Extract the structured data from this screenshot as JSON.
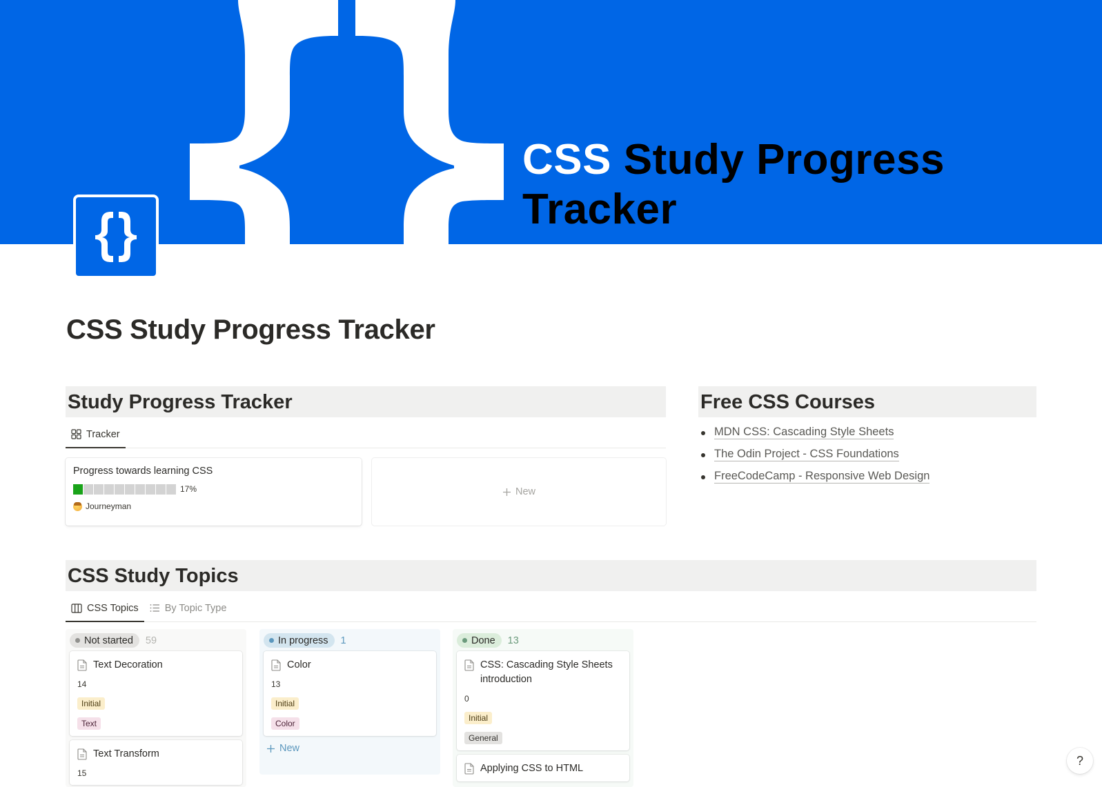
{
  "cover": {
    "title_highlight": "CSS",
    "title_rest_line1": " Study Progress",
    "title_line2": "Tracker",
    "background_color": "#0066e6",
    "icon": "curly-braces-icon"
  },
  "page": {
    "icon": "curly-braces-icon",
    "title": "CSS Study Progress Tracker"
  },
  "tracker_section": {
    "heading": "Study Progress Tracker",
    "tabs": [
      {
        "label": "Tracker",
        "icon": "gallery-icon",
        "active": true
      }
    ],
    "progress_card": {
      "title": "Progress towards learning CSS",
      "progress_percent": 17,
      "progress_label": "17%",
      "segments_total": 10,
      "segments_filled": 1,
      "level_emoji": "face-emoji",
      "level_label": "Journeyman"
    },
    "new_card_label": "New"
  },
  "courses_section": {
    "heading": "Free CSS Courses",
    "links": [
      {
        "label": "MDN CSS: Cascading Style Sheets"
      },
      {
        "label": "The Odin Project - CSS Foundations"
      },
      {
        "label": "FreeCodeCamp - Responsive Web Design"
      }
    ]
  },
  "topics_section": {
    "heading": "CSS Study Topics",
    "tabs": [
      {
        "label": "CSS Topics",
        "icon": "board-icon",
        "active": true
      },
      {
        "label": "By Topic Type",
        "icon": "list-icon",
        "active": false
      }
    ],
    "columns": [
      {
        "status": "Not started",
        "count": "59",
        "color": "#91918e",
        "cards": [
          {
            "title": "Text Decoration",
            "number": "14",
            "level_tag": "Initial",
            "type_tag": "Text"
          },
          {
            "title": "Text Transform",
            "number": "15"
          }
        ]
      },
      {
        "status": "In progress",
        "count": "1",
        "color": "#5b97bd",
        "cards": [
          {
            "title": "Color",
            "number": "13",
            "level_tag": "Initial",
            "type_tag": "Color"
          }
        ],
        "add_label": "New"
      },
      {
        "status": "Done",
        "count": "13",
        "color": "#6c9b7d",
        "cards": [
          {
            "title": "CSS: Cascading Style Sheets introduction",
            "number": "0",
            "level_tag": "Initial",
            "type_tag": "General"
          },
          {
            "title": "Applying CSS to HTML"
          }
        ]
      }
    ]
  },
  "help_button": {
    "label": "?"
  }
}
